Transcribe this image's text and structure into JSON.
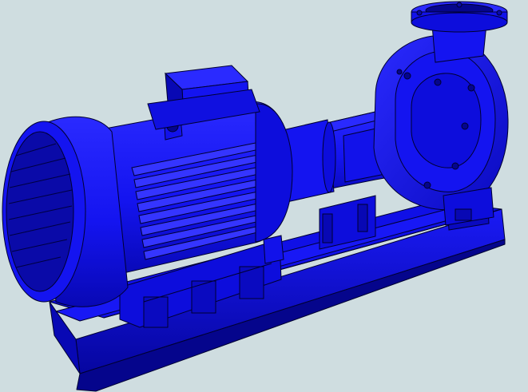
{
  "scene": {
    "subject": "pump-motor-assembly",
    "colors": {
      "background": "#cfdde0",
      "body": "#1414f0",
      "body_light": "#2a2aff",
      "body_mid": "#0d0ddc",
      "body_dark": "#0808b4",
      "body_deep": "#05058c",
      "outline": "#000030",
      "rib_light": "#3535ff",
      "grille": "#0a0aa8"
    }
  }
}
